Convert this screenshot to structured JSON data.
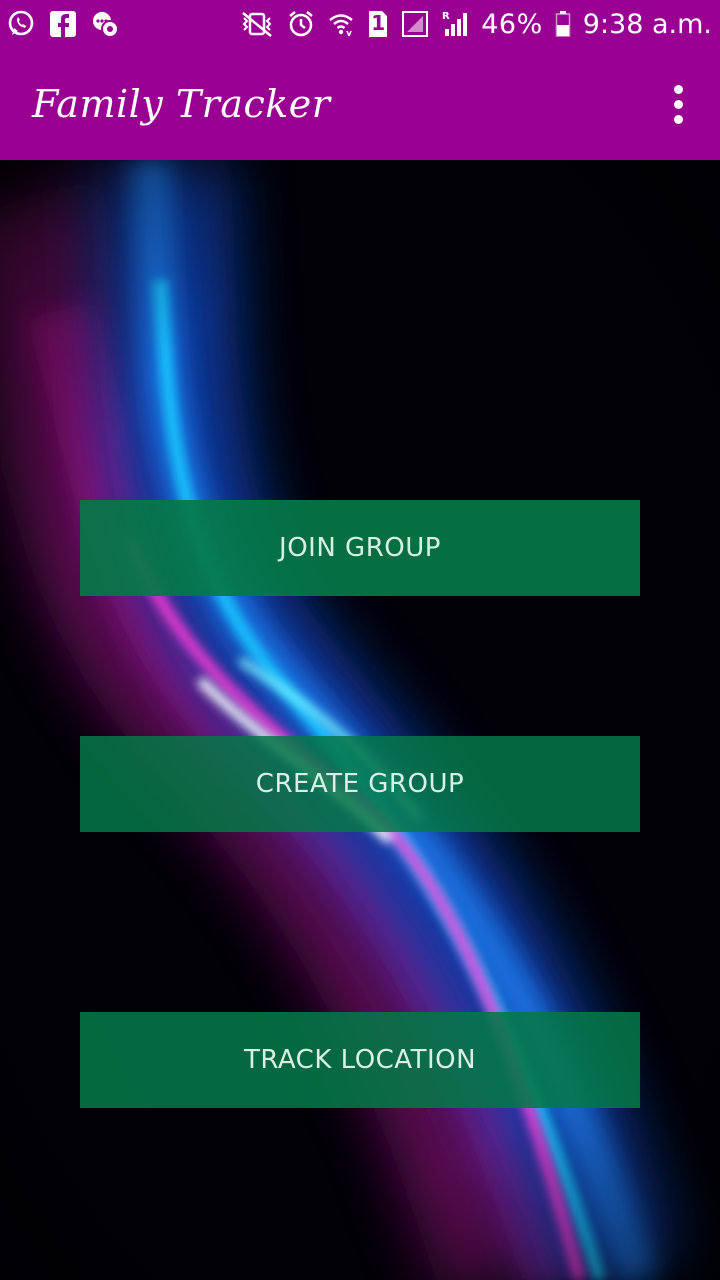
{
  "status_bar": {
    "battery": "46%",
    "time": "9:38 a.m.",
    "sim_slot": "1",
    "icons_left": [
      "whatsapp-icon",
      "facebook-icon",
      "messenger-icon"
    ],
    "icons_right": [
      "vibrate-icon",
      "alarm-icon",
      "wifi-icon",
      "sim-icon",
      "signal-icon",
      "roaming-signal-icon",
      "battery-icon"
    ]
  },
  "app_bar": {
    "title": "Family Tracker",
    "color": "#990091"
  },
  "buttons": {
    "join": "JOIN GROUP",
    "create": "CREATE GROUP",
    "track": "TRACK LOCATION",
    "color": "#057848"
  }
}
